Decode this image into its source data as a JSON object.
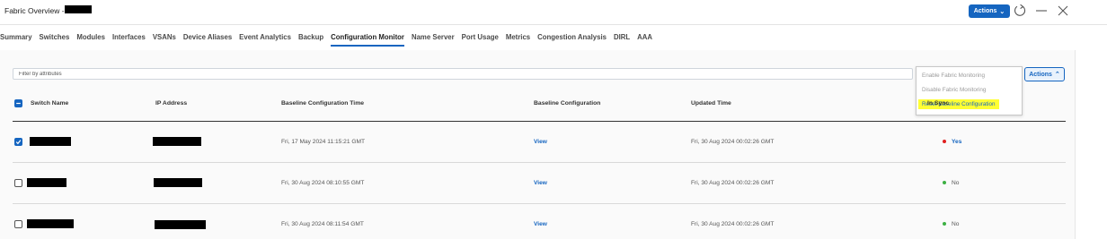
{
  "header": {
    "title": "Fabric Overview -",
    "actions_label": "Actions",
    "colors": {
      "accent": "#1565c0"
    }
  },
  "tabs": [
    {
      "label": "Summary"
    },
    {
      "label": "Switches"
    },
    {
      "label": "Modules"
    },
    {
      "label": "Interfaces"
    },
    {
      "label": "VSANs"
    },
    {
      "label": "Device Aliases"
    },
    {
      "label": "Event Analytics"
    },
    {
      "label": "Backup"
    },
    {
      "label": "Configuration Monitor",
      "active": true
    },
    {
      "label": "Name Server"
    },
    {
      "label": "Port Usage"
    },
    {
      "label": "Metrics"
    },
    {
      "label": "Congestion Analysis"
    },
    {
      "label": "DIRL"
    },
    {
      "label": "AAA"
    }
  ],
  "filter": {
    "placeholder": "Filter by attributes"
  },
  "table_actions": {
    "label": "Actions",
    "menu": [
      {
        "label": "Enable Fabric Monitoring",
        "disabled": true
      },
      {
        "label": "Disable Fabric Monitoring",
        "disabled": true
      },
      {
        "label": "Reset Baseline Configuration",
        "highlighted": true
      }
    ]
  },
  "table": {
    "columns": [
      "Switch Name",
      "IP Address",
      "Baseline Configuration Time",
      "Baseline Configuration",
      "Updated Time",
      "In Sync"
    ],
    "rows": [
      {
        "selected": true,
        "baseline_time": "Fri, 17 May 2024 11:15:21 GMT",
        "baseline_config": "View",
        "updated": "Fri, 30 Aug 2024 00:02:26 GMT",
        "status": "Yes",
        "status_color": "#e02020"
      },
      {
        "selected": false,
        "baseline_time": "Fri, 30 Aug 2024 08:10:55 GMT",
        "baseline_config": "View",
        "updated": "Fri, 30 Aug 2024 00:02:26 GMT",
        "status": "No",
        "status_color": "#3cb043"
      },
      {
        "selected": false,
        "baseline_time": "Fri, 30 Aug 2024 08:11:54 GMT",
        "baseline_config": "View",
        "updated": "Fri, 30 Aug 2024 00:02:26 GMT",
        "status": "No",
        "status_color": "#3cb043"
      }
    ]
  }
}
